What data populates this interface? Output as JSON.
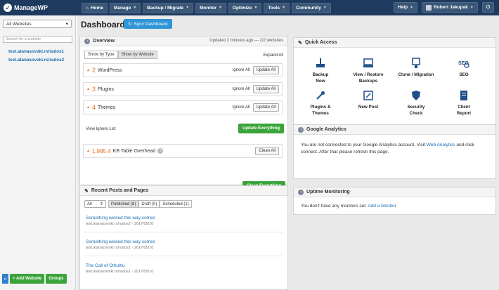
{
  "app": {
    "logo_text": "ManageWP"
  },
  "nav": {
    "home": "Home",
    "items": [
      "Manage",
      "Backup / Migrate",
      "Monitor",
      "Optimize",
      "Tools",
      "Community"
    ],
    "help": "Help",
    "user": "Robert Jakupak"
  },
  "sidebar": {
    "filter_value": "All Websites",
    "search_placeholder": "Search for a website",
    "sites": [
      "test.atanasovski.rs/rados1",
      "test.atanasovski.rs/rados2"
    ],
    "add_website": "+ Add Website",
    "groups": "Groups",
    "collapse_glyph": "«"
  },
  "dashboard": {
    "title": "Dashboard",
    "sync_label": "Sync Dashboard"
  },
  "overview": {
    "title": "Overview",
    "updated": "Updated 2 minutes ago — 2/2 websites",
    "tab_type": "Show by Type",
    "tab_website": "Show by Website",
    "expand_all": "Expand All",
    "rows": [
      {
        "count": "2",
        "label": "WordPress",
        "ignore": "Ignore All",
        "button": "Update All"
      },
      {
        "count": "3",
        "label": "Plugins",
        "ignore": "Ignore All",
        "button": "Update All"
      },
      {
        "count": "4",
        "label": "Themes",
        "ignore": "Ignore All",
        "button": "Update All"
      }
    ],
    "view_ignore": "View Ignore List",
    "update_everything": "Update Everything",
    "kb_value": "1,995.4",
    "kb_label": "KB Table Overhead",
    "help_glyph": "?",
    "clean_all": "Clean All",
    "clean_everything": "Clean Everything"
  },
  "recent": {
    "title": "Recent Posts and Pages",
    "filter": "All",
    "tabs": [
      "Published (8)",
      "Draft (0)",
      "Scheduled (1)"
    ],
    "posts": [
      {
        "title": "Something wicked this way comes",
        "meta": "test.atanasovski.rs/rados2 - 2017/05/10"
      },
      {
        "title": "Something wicked this way comes",
        "meta": "test.atanasovski.rs/rados1 - 2017/05/10"
      },
      {
        "title": "The Call of Cthulhu",
        "meta": "test.atanasovski.rs/rados1 - 2017/05/10"
      }
    ]
  },
  "quick_access": {
    "title": "Quick Access",
    "items": [
      {
        "label1": "Backup",
        "label2": "Now",
        "icon": "backup-icon"
      },
      {
        "label1": "View / Restore",
        "label2": "Backups",
        "icon": "restore-icon"
      },
      {
        "label1": "Clone / Migration",
        "label2": "",
        "icon": "clone-icon"
      },
      {
        "label1": "SEO",
        "label2": "",
        "icon": "seo-icon"
      },
      {
        "label1": "Plugins &",
        "label2": "Themes",
        "icon": "plugins-icon"
      },
      {
        "label1": "New Post",
        "label2": "",
        "icon": "new-post-icon"
      },
      {
        "label1": "Security",
        "label2": "Check",
        "icon": "security-icon"
      },
      {
        "label1": "Client",
        "label2": "Report",
        "icon": "report-icon"
      }
    ]
  },
  "analytics": {
    "title": "Google Analytics",
    "text1": "You are not connected to your Google Analytics account. Visit ",
    "link": "Web Analytics",
    "text2": " and click connect. After that please refresh this page."
  },
  "uptime": {
    "title": "Uptime Monitoring",
    "text": "You don't have any monitors set. ",
    "link": "Add a Monitor"
  },
  "colors": {
    "nav_bg": "#1e3a5f",
    "accent": "#2f95d6",
    "green": "#3aa43a",
    "orange": "#e07020",
    "link": "#1a6fb5"
  }
}
